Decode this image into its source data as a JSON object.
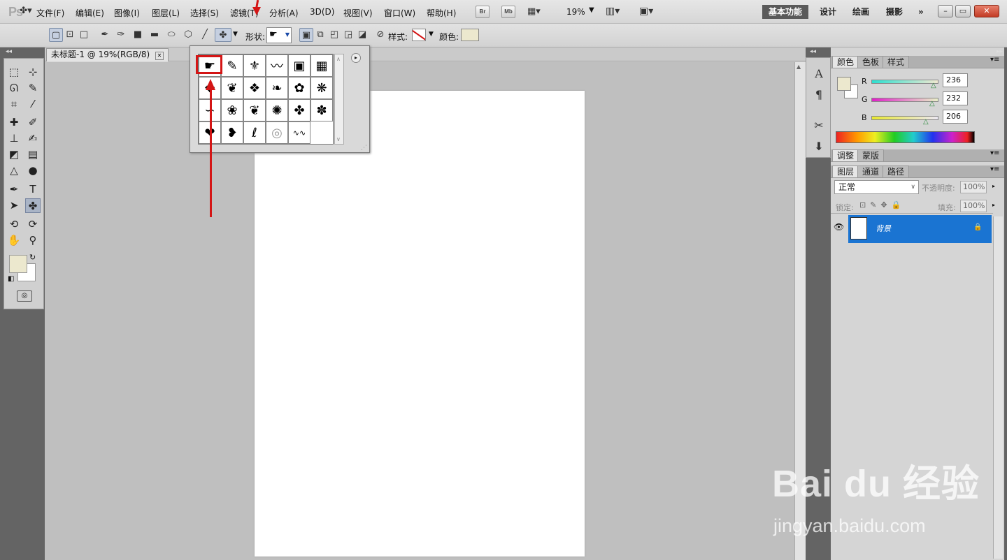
{
  "app": {
    "logo": "Ps"
  },
  "menubar": {
    "items": [
      "文件(F)",
      "编辑(E)",
      "图像(I)",
      "图层(L)",
      "选择(S)",
      "滤镜(T)",
      "分析(A)",
      "3D(D)",
      "视图(V)",
      "窗口(W)",
      "帮助(H)"
    ],
    "bridge": "Br",
    "minibridge": "Mb",
    "zoom": "19%",
    "workspaces": [
      "基本功能",
      "设计",
      "绘画",
      "摄影"
    ],
    "more": "»",
    "window_buttons": [
      "–",
      "▭",
      "✕"
    ]
  },
  "options": {
    "shape_label": "形状:",
    "style_label": "样式:",
    "color_label": "颜色:",
    "color": "#ece8ce"
  },
  "document": {
    "tab_title": "未标题-1 @ 19%(RGB/8)",
    "tab_close": "✕"
  },
  "shape_picker": {
    "shapes": [
      "☛",
      "✎",
      "⚜",
      "〰",
      "▣",
      "▦",
      "✥",
      "❦",
      "❖",
      "❧",
      "✿",
      "❋",
      "∽",
      "❀",
      "❦",
      "✺",
      "✤",
      "✽",
      "❤",
      "❥",
      "ℓ",
      "◎",
      "∿∿"
    ],
    "menu_arrow": "▸"
  },
  "color_panel": {
    "tabs": [
      "颜色",
      "色板",
      "样式"
    ],
    "channels": [
      {
        "label": "R",
        "value": "236"
      },
      {
        "label": "G",
        "value": "232"
      },
      {
        "label": "B",
        "value": "206"
      }
    ]
  },
  "adjust_panel": {
    "tabs": [
      "调整",
      "蒙版"
    ]
  },
  "layers_panel": {
    "tabs": [
      "图层",
      "通道",
      "路径"
    ],
    "blend_mode": "正常",
    "opacity_label": "不透明度:",
    "opacity": "100%",
    "lock_label": "锁定:",
    "fill_label": "填充:",
    "fill": "100%",
    "layers": [
      {
        "name": "背景"
      }
    ]
  },
  "watermark": {
    "brand": "Bai du 经验",
    "url": "jingyan.baidu.com"
  },
  "colors": {
    "accent": "#1a74d2",
    "annotation": "#d41515"
  }
}
